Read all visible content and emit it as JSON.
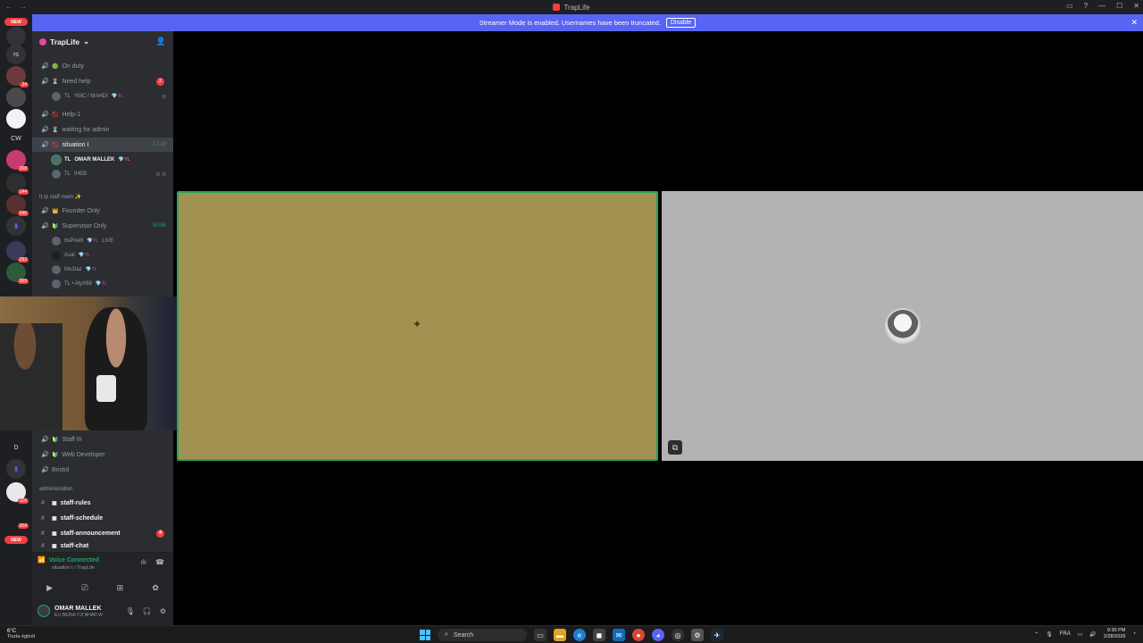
{
  "window": {
    "title": "TrapLife",
    "controls": [
      "—",
      "☐",
      "✕"
    ]
  },
  "banner": {
    "message": "Streamer Mode is enabled. Usernames have been truncated.",
    "button": "Disable"
  },
  "guilds": {
    "new_label": "NEW",
    "items": [
      {
        "text": "rs",
        "badge": ""
      },
      {
        "text": "",
        "badge": "34"
      },
      {
        "text": "",
        "badge": ""
      },
      {
        "text": "CW",
        "badge": ""
      },
      {
        "text": "",
        "badge": "368"
      },
      {
        "text": "",
        "badge": "144"
      },
      {
        "text": "",
        "badge": "346"
      },
      {
        "text": "",
        "badge": ""
      },
      {
        "text": "",
        "badge": "292"
      },
      {
        "text": "",
        "badge": "369"
      },
      {
        "text": "D",
        "badge": ""
      },
      {
        "text": "",
        "badge": ""
      },
      {
        "text": "",
        "badge": "116"
      },
      {
        "text": "",
        "badge": "304"
      }
    ]
  },
  "sidebar": {
    "server_name": "TrapLife",
    "channels": [
      {
        "name": "On duty",
        "emoji": "🟢",
        "y": 0,
        "mention": "",
        "timer": "",
        "live": ""
      },
      {
        "name": "Need help",
        "emoji": "⌛",
        "y": 0,
        "mention": "2",
        "timer": "",
        "live": ""
      },
      {
        "name": "Help-1",
        "emoji": "🚫",
        "y": 0,
        "mention": "",
        "timer": "",
        "live": ""
      },
      {
        "name": "waiting for admin",
        "emoji": "⌛",
        "y": 0,
        "mention": "",
        "timer": "",
        "live": ""
      },
      {
        "name": "situation I",
        "emoji": "🚫",
        "y": 0,
        "mention": "",
        "timer": "17:10",
        "live": ""
      }
    ],
    "members_need_help": [
      {
        "tag": "TL",
        "name": "YMC / MAHDI",
        "suffix": "💎TL"
      }
    ],
    "members_situation": [
      {
        "tag": "TL",
        "name": "OMAR MALLEK",
        "suffix": "💎TL"
      },
      {
        "tag": "TL",
        "name": "IHEB",
        "suffix": ""
      }
    ],
    "staff_category": "tl.rp staff room ✨",
    "staff_channels": [
      {
        "name": "Founder Only",
        "timer": ""
      },
      {
        "name": "Supervisor Only",
        "timer": "50:58"
      }
    ],
    "supervisor_members": [
      {
        "name": "ItsPirelli",
        "suffix": "💎TL",
        "live": "LIVE"
      },
      {
        "name": "Asal",
        "suffix": "💎TL",
        "live": ""
      },
      {
        "name": "Mo3taz",
        "suffix": "💎TL",
        "live": ""
      },
      {
        "name": "TL • AlyX69",
        "suffix": "💎TL",
        "live": ""
      }
    ],
    "lower_channels": [
      {
        "name": "Staff III"
      },
      {
        "name": "Web Developer"
      },
      {
        "name": "Bristol"
      }
    ],
    "admin_category": "administration",
    "text_channels": [
      {
        "name": "staff-rules",
        "mention": ""
      },
      {
        "name": "staff-schedule",
        "mention": ""
      },
      {
        "name": "staff-announcement",
        "mention": "4"
      },
      {
        "name": "staff-chat",
        "mention": ""
      }
    ]
  },
  "voice": {
    "status": "Voice Connected",
    "location": "situation I / TrapLife"
  },
  "user": {
    "name": "OMAR MALLEK",
    "status": "ELI BEINA YJI NHAR W"
  },
  "taskbar": {
    "weather_temp": "6°C",
    "weather_desc": "Tiszta égbolt",
    "search_placeholder": "Search",
    "language": "FRA",
    "time": "9:30 PM",
    "date": "2/28/2026"
  }
}
